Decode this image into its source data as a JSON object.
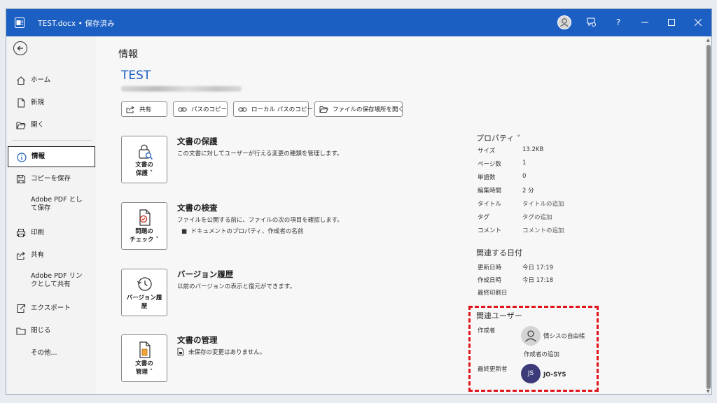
{
  "window": {
    "title": "TEST.docx • 保存済み",
    "help_label": "?"
  },
  "sidebar": {
    "items": [
      {
        "label": "ホーム"
      },
      {
        "label": "新規"
      },
      {
        "label": "開く"
      },
      {
        "label": "情報"
      },
      {
        "label": "コピーを保存"
      },
      {
        "label": "Adobe PDF として保存"
      },
      {
        "label": "印刷"
      },
      {
        "label": "共有"
      },
      {
        "label": "Adobe PDF リンクとして共有"
      },
      {
        "label": "エクスポート"
      },
      {
        "label": "閉じる"
      },
      {
        "label": "その他..."
      }
    ],
    "active": "情報"
  },
  "main": {
    "heading": "情報",
    "doc_name": "TEST",
    "buttons": {
      "share": "共有",
      "copy_path": "パスのコピー",
      "copy_local_path": "ローカル パスのコピー",
      "open_location": "ファイルの保存場所を開く"
    },
    "sections": [
      {
        "tile_line1": "文書の",
        "tile_line2": "保護 ˅",
        "title": "文書の保護",
        "desc": "この文書に対してユーザーが行える変更の種類を管理します。"
      },
      {
        "tile_line1": "問題の",
        "tile_line2": "チェック ˅",
        "title": "文書の検査",
        "desc": "ファイルを公開する前に、ファイルの次の項目を確認します。",
        "bullet": "ドキュメントのプロパティ、作成者の名前"
      },
      {
        "tile_line1": "バージョン履",
        "tile_line2": "歴",
        "title": "バージョン履歴",
        "desc": "以前のバージョンの表示と復元ができます。"
      },
      {
        "tile_line1": "文書の",
        "tile_line2": "管理 ˅",
        "title": "文書の管理",
        "desc": "未保存の変更はありません。"
      }
    ]
  },
  "properties": {
    "heading": "プロパティ ˅",
    "rows": [
      {
        "key": "サイズ",
        "value": "13.2KB"
      },
      {
        "key": "ページ数",
        "value": "1"
      },
      {
        "key": "単語数",
        "value": "0"
      },
      {
        "key": "編集時間",
        "value": "2 分"
      },
      {
        "key": "タイトル",
        "value": "タイトルの追加"
      },
      {
        "key": "タグ",
        "value": "タグの追加"
      },
      {
        "key": "コメント",
        "value": "コメントの追加"
      }
    ],
    "dates_heading": "関連する日付",
    "dates": [
      {
        "key": "更新日時",
        "value": "今日 17:19"
      },
      {
        "key": "作成日時",
        "value": "今日 17:18"
      },
      {
        "key": "最終印刷日",
        "value": ""
      }
    ],
    "users_heading": "関連ユーザー",
    "author_label": "作成者",
    "author_name": "情シスの自由帳",
    "add_author": "作成者の追加",
    "last_modified_label": "最終更新者",
    "last_modified_initials": "JS",
    "last_modified_name": "JO-SYS"
  },
  "colors": {
    "titlebar": "#1c5fc2",
    "accent": "#1c5fc2",
    "highlight": "#e0141b",
    "user_avatar": "#3d3a7a"
  }
}
